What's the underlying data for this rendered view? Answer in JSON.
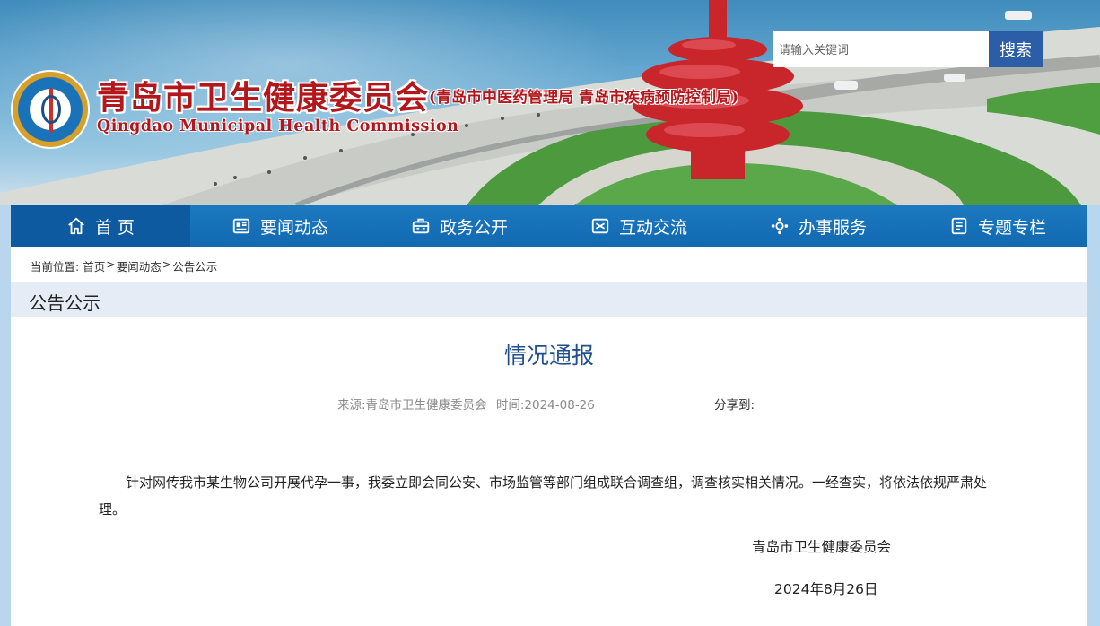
{
  "header": {
    "title_cn": "青岛市卫生健康委员会",
    "title_sub": "(青岛市中医药管理局 青岛市疾病预防控制局)",
    "title_en": "Qingdao Municipal Health Commission",
    "logo_icon": "health-commission-emblem-icon",
    "search": {
      "placeholder": "请输入关键词",
      "button_label": "搜索"
    }
  },
  "nav": {
    "items": [
      {
        "label": "首 页",
        "icon": "home-icon"
      },
      {
        "label": "要闻动态",
        "icon": "news-icon"
      },
      {
        "label": "政务公开",
        "icon": "briefcase-icon"
      },
      {
        "label": "互动交流",
        "icon": "exchange-icon"
      },
      {
        "label": "办事服务",
        "icon": "service-icon"
      },
      {
        "label": "专题专栏",
        "icon": "topic-icon"
      }
    ],
    "active_index": 0
  },
  "breadcrumb": {
    "prefix": "当前位置:",
    "items": [
      "首页",
      "要闻动态",
      "公告公示"
    ],
    "separator": ">"
  },
  "section": {
    "title": "公告公示"
  },
  "article": {
    "title": "情况通报",
    "source_label": "来源:青岛市卫生健康委员会",
    "time_label": "时间:2024-08-26",
    "share_label": "分享到:",
    "body": "针对网传我市某生物公司开展代孕一事，我委立即会同公安、市场监管等部门组成联合调查组，调查核实相关情况。一经查实，将依法依规严肃处理。",
    "signature": "青岛市卫生健康委员会",
    "date": "2024年8月26日"
  },
  "colors": {
    "nav_bg": "#1269b0",
    "title_red": "#b3171b",
    "article_title_blue": "#1f4f8f",
    "search_button": "#2c5ea8"
  }
}
